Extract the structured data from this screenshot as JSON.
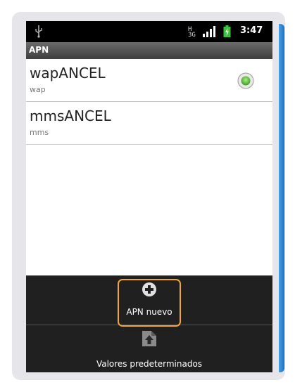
{
  "status_bar": {
    "time": "3:47",
    "network": [
      "H",
      "3G"
    ],
    "icons": [
      "usb-icon",
      "network-type-icon",
      "signal-icon",
      "battery-charging-icon"
    ]
  },
  "header": {
    "title": "APN"
  },
  "apn_list": [
    {
      "name": "wapANCEL",
      "type": "wap",
      "selected": true
    },
    {
      "name": "mmsANCEL",
      "type": "mms",
      "selected": false
    }
  ],
  "menu": {
    "items": [
      {
        "label": "APN nuevo",
        "icon": "add-icon",
        "highlighted": true
      },
      {
        "label": "Valores predeterminados",
        "icon": "restore-defaults-icon",
        "highlighted": false
      }
    ]
  },
  "colors": {
    "highlight": "#f2a62a",
    "radio_selected": "#6cc644",
    "accent_edge": "#1a70c8"
  }
}
